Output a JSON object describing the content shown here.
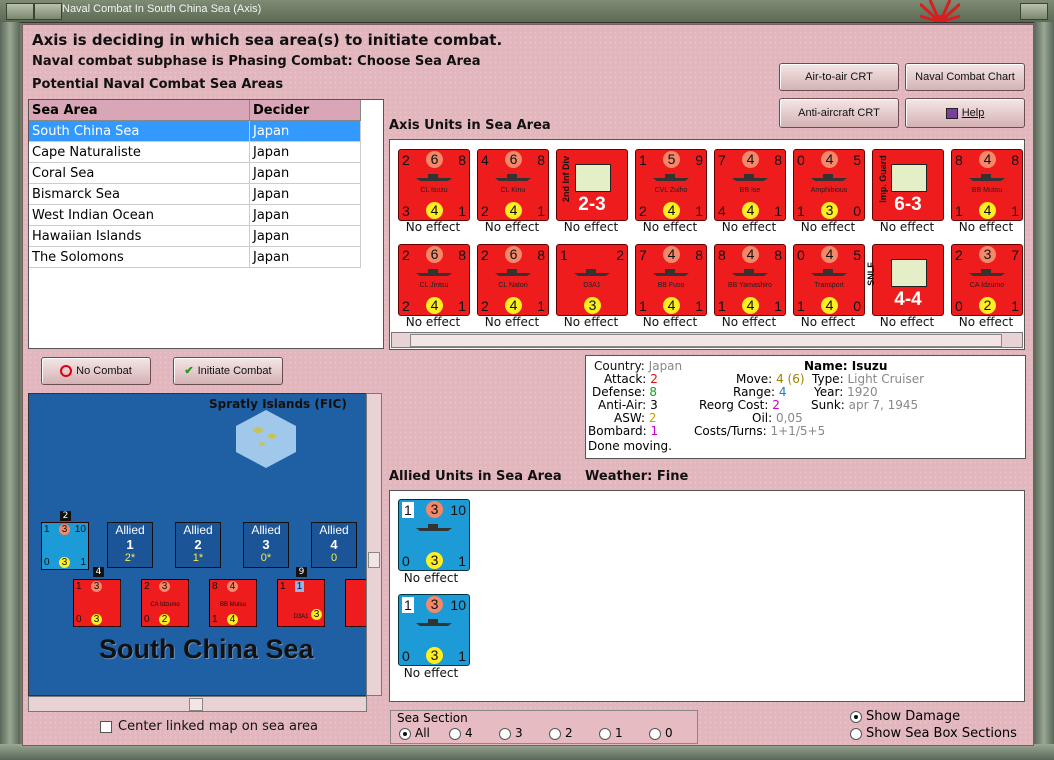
{
  "window": {
    "title": "Naval Combat In South China Sea (Axis)"
  },
  "header": {
    "line1": "Axis is deciding in which sea area(s) to initiate combat.",
    "line2": "Naval combat subphase is Phasing Combat: Choose Sea Area",
    "line3": "Potential Naval Combat Sea Areas"
  },
  "buttons": {
    "air_crt": "Air-to-air CRT",
    "naval_chart": "Naval Combat Chart",
    "aa_crt": "Anti-aircraft CRT",
    "help": "Help",
    "no_combat": "No Combat",
    "initiate_combat": "Initiate Combat"
  },
  "areas_table": {
    "headers": [
      "Sea Area",
      "Decider"
    ],
    "rows": [
      [
        "South China Sea",
        "Japan"
      ],
      [
        "Cape Naturaliste",
        "Japan"
      ],
      [
        "Coral Sea",
        "Japan"
      ],
      [
        "Bismarck Sea",
        "Japan"
      ],
      [
        "West Indian Ocean",
        "Japan"
      ],
      [
        "Hawaiian Islands",
        "Japan"
      ],
      [
        "The Solomons",
        "Japan"
      ]
    ]
  },
  "axis_units_label": "Axis Units in Sea Area",
  "axis_units": [
    {
      "tl": "2",
      "tm": "6",
      "tr": "8",
      "bl": "3",
      "bm": "4",
      "br": "1",
      "name": "CL Isuzu",
      "effect": "No effect"
    },
    {
      "tl": "4",
      "tm": "6",
      "tr": "8",
      "bl": "2",
      "bm": "4",
      "br": "1",
      "name": "CL Kinu",
      "effect": "No effect"
    },
    {
      "tl": "",
      "tm": "",
      "tr": "",
      "bl": "",
      "bm": "",
      "br": "",
      "name": "2nd Inf Div",
      "label": "2-3",
      "effect": "No effect"
    },
    {
      "tl": "1",
      "tm": "5",
      "tr": "9",
      "bl": "2",
      "bm": "4",
      "br": "1",
      "name": "CVL Zuiho",
      "effect": "No effect"
    },
    {
      "tl": "7",
      "tm": "4",
      "tr": "8",
      "bl": "4",
      "bm": "4",
      "br": "1",
      "name": "BB Ise",
      "effect": "No effect"
    },
    {
      "tl": "0",
      "tm": "4",
      "tr": "5",
      "bl": "1",
      "bm": "3",
      "br": "0",
      "name": "Amphibious",
      "effect": "No effect"
    },
    {
      "tl": "",
      "tm": "",
      "tr": "",
      "bl": "",
      "bm": "",
      "br": "",
      "name": "Imp. Guard",
      "label": "6-3",
      "effect": "No effect"
    },
    {
      "tl": "8",
      "tm": "4",
      "tr": "8",
      "bl": "1",
      "bm": "4",
      "br": "1",
      "name": "BB Mutsu",
      "effect": "No effect"
    },
    {
      "tl": "2",
      "tm": "6",
      "tr": "8",
      "bl": "2",
      "bm": "4",
      "br": "1",
      "name": "CL Jintsu",
      "effect": "No effect"
    },
    {
      "tl": "2",
      "tm": "6",
      "tr": "8",
      "bl": "2",
      "bm": "4",
      "br": "1",
      "name": "CL Natori",
      "effect": "No effect"
    },
    {
      "tl": "1",
      "tm": "",
      "tr": "2",
      "bl": "",
      "bm": "3",
      "br": "",
      "name": "D3A1",
      "effect": "No effect"
    },
    {
      "tl": "7",
      "tm": "4",
      "tr": "8",
      "bl": "1",
      "bm": "4",
      "br": "1",
      "name": "BB Fuso",
      "effect": "No effect"
    },
    {
      "tl": "8",
      "tm": "4",
      "tr": "8",
      "bl": "1",
      "bm": "4",
      "br": "1",
      "name": "BB Yamashiro",
      "effect": "No effect"
    },
    {
      "tl": "0",
      "tm": "4",
      "tr": "5",
      "bl": "1",
      "bm": "4",
      "br": "0",
      "name": "Transport",
      "effect": "No effect"
    },
    {
      "tl": "",
      "tm": "",
      "tr": "",
      "bl": "",
      "bm": "",
      "br": "",
      "name": "SNLF",
      "label": "4-4",
      "effect": "No effect"
    },
    {
      "tl": "2",
      "tm": "3",
      "tr": "7",
      "bl": "0",
      "bm": "2",
      "br": "1",
      "name": "CA Idzumo",
      "effect": "No effect"
    }
  ],
  "info": {
    "country_label": "Country:",
    "country": "Japan",
    "attack_label": "Attack:",
    "attack": "2",
    "defense_label": "Defense:",
    "defense": "8",
    "antiair_label": "Anti-Air:",
    "antiair": "3",
    "asw_label": "ASW:",
    "asw": "2",
    "bombard_label": "Bombard:",
    "bombard": "1",
    "done": "Done moving.",
    "name_label": "Name:",
    "name": "Isuzu",
    "move_label": "Move:",
    "move": "4 (6)",
    "range_label": "Range:",
    "range": "4",
    "reorg_label": "Reorg Cost:",
    "reorg": "2",
    "oil_label": "Oil:",
    "oil": "0,05",
    "costs_label": "Costs/Turns:",
    "costs": "1+1/5+5",
    "type_label": "Type:",
    "type": "Light Cruiser",
    "year_label": "Year:",
    "year": "1920",
    "sunk_label": "Sunk:",
    "sunk": "apr 7, 1945"
  },
  "allied_units_label": "Allied Units in Sea Area",
  "weather_label": "Weather:",
  "weather": "Fine",
  "allied_units": [
    {
      "tl": "1",
      "tm": "3",
      "tr": "10",
      "bl": "0",
      "bm": "3",
      "br": "1",
      "effect": "No effect"
    },
    {
      "tl": "1",
      "tm": "3",
      "tr": "10",
      "bl": "0",
      "bm": "3",
      "br": "1",
      "effect": "No effect"
    }
  ],
  "map": {
    "island_label": "Spratly Islands (FIC)",
    "sea_label": "South China Sea",
    "allied_boxes": [
      {
        "title": "Allied",
        "num": "1",
        "val": "2*"
      },
      {
        "title": "Allied",
        "num": "2",
        "val": "1*"
      },
      {
        "title": "Allied",
        "num": "3",
        "val": "0*"
      },
      {
        "title": "Allied",
        "num": "4",
        "val": "0"
      }
    ],
    "stack_counts": [
      "2",
      "4",
      "9"
    ],
    "mini_units": [
      {
        "name": "",
        "tl": "1",
        "tm": "3",
        "tr": "10",
        "bl": "0",
        "bm": "3",
        "br": "1"
      },
      {
        "name": "",
        "tl": "1",
        "tm": "3",
        "tr": "",
        "bl": "0",
        "bm": "3",
        "br": ""
      },
      {
        "name": "CA Idzumo",
        "tl": "2",
        "tm": "3",
        "tr": "",
        "bl": "0",
        "bm": "2",
        "br": ""
      },
      {
        "name": "BB Mutsu",
        "tl": "8",
        "tm": "4",
        "tr": "",
        "bl": "1",
        "bm": "4",
        "br": ""
      },
      {
        "name": "D3A1",
        "tl": "1",
        "tm": "1",
        "tr": "",
        "bl": "",
        "bm": "3",
        "br": ""
      }
    ]
  },
  "center_map": "Center linked map on sea area",
  "sea_section": {
    "label": "Sea Section",
    "options": [
      "All",
      "4",
      "3",
      "2",
      "1",
      "0"
    ]
  },
  "show_damage": "Show Damage",
  "show_sections": "Show Sea Box Sections",
  "colors": {
    "accent": "#3399ff",
    "axis_unit": "#ee1c1c",
    "allied_unit": "#1d9bd6",
    "background": "#e2b6bd"
  }
}
